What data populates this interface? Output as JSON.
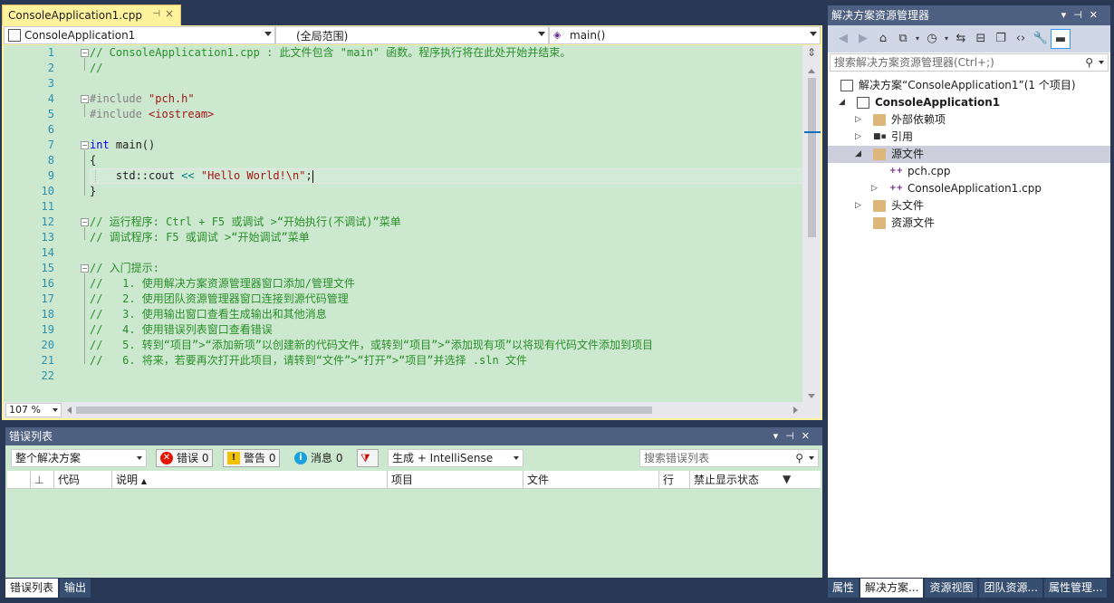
{
  "editor": {
    "tab_label": "ConsoleApplication1.cpp",
    "nav_project": "ConsoleApplication1",
    "nav_scope": "(全局范围)",
    "nav_member": "main()",
    "zoom": "107 %",
    "line_numbers": [
      "1",
      "2",
      "3",
      "4",
      "5",
      "6",
      "7",
      "8",
      "9",
      "10",
      "11",
      "12",
      "13",
      "14",
      "15",
      "16",
      "17",
      "18",
      "19",
      "20",
      "21",
      "22"
    ],
    "lines": {
      "l1": "// ConsoleApplication1.cpp : 此文件包含 \"main\" 函数。程序执行将在此处开始并结束。",
      "l2": "//",
      "l4_kw": "#include ",
      "l4_str": "\"pch.h\"",
      "l5_kw": "#include ",
      "l5_str": "<iostream>",
      "l7_kw": "int",
      "l7_rest": " main()",
      "l8": "{",
      "l9_a": "    std::cout ",
      "l9_op": "<<",
      "l9_b": " ",
      "l9_str": "\"Hello World!\\n\"",
      "l9_c": ";",
      "l10": "}",
      "l12": "// 运行程序: Ctrl + F5 或调试 >“开始执行(不调试)”菜单",
      "l13": "// 调试程序: F5 或调试 >“开始调试”菜单",
      "l15": "// 入门提示:",
      "l16": "//   1. 使用解决方案资源管理器窗口添加/管理文件",
      "l17": "//   2. 使用团队资源管理器窗口连接到源代码管理",
      "l18": "//   3. 使用输出窗口查看生成输出和其他消息",
      "l19": "//   4. 使用错误列表窗口查看错误",
      "l20": "//   5. 转到“项目”>“添加新项”以创建新的代码文件，或转到“项目”>“添加现有项”以将现有代码文件添加到项目",
      "l21": "//   6. 将来，若要再次打开此项目，请转到“文件”>“打开”>“项目”并选择 .sln 文件"
    }
  },
  "error_list": {
    "title": "错误列表",
    "scope": "整个解决方案",
    "errors": "错误 0",
    "warnings": "警告 0",
    "messages": "消息 0",
    "source": "生成 + IntelliSense",
    "search_placeholder": "搜索错误列表",
    "columns": [
      "代码",
      "说明",
      "项目",
      "文件",
      "行",
      "禁止显示状态"
    ]
  },
  "bottom_tabs": [
    "错误列表",
    "输出"
  ],
  "solution_explorer": {
    "title": "解决方案资源管理器",
    "search_placeholder": "搜索解决方案资源管理器(Ctrl+;)",
    "solution": "解决方案“ConsoleApplication1”(1 个项目)",
    "project": "ConsoleApplication1",
    "external_deps": "外部依赖项",
    "references": "引用",
    "source_files": "源文件",
    "file_pch": "pch.cpp",
    "file_main": "ConsoleApplication1.cpp",
    "header_files": "头文件",
    "resource_files": "资源文件"
  },
  "side_tabs": [
    "属性",
    "解决方案...",
    "资源视图",
    "团队资源...",
    "属性管理..."
  ]
}
